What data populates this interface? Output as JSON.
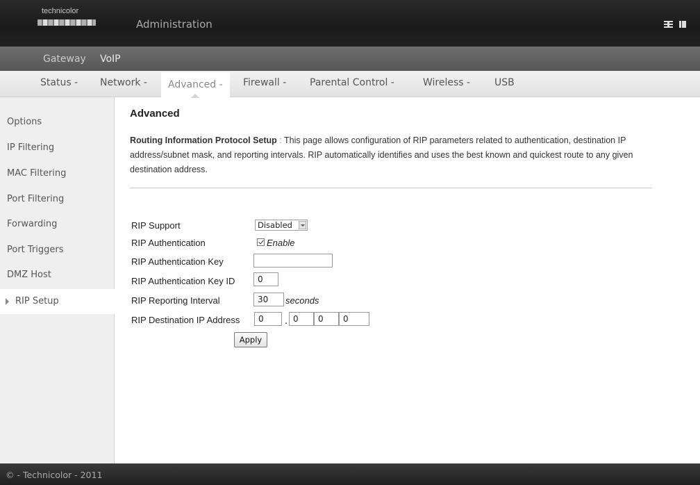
{
  "header": {
    "logo_text": "technicolor",
    "title": "Administration",
    "icons": [
      "language-icon",
      "logout-icon"
    ]
  },
  "subnav": {
    "items": [
      {
        "label": "Gateway"
      },
      {
        "label": "VoIP"
      }
    ]
  },
  "mainnav": {
    "items": [
      {
        "label": "Status -"
      },
      {
        "label": "Network -"
      },
      {
        "label": "Advanced -"
      },
      {
        "label": "Firewall -"
      },
      {
        "label": "Parental Control -"
      },
      {
        "label": "Wireless -"
      },
      {
        "label": "USB"
      }
    ],
    "active_index": 2
  },
  "sidebar": {
    "items": [
      {
        "label": "Options"
      },
      {
        "label": "IP Filtering"
      },
      {
        "label": "MAC Filtering"
      },
      {
        "label": "Port Filtering"
      },
      {
        "label": "Forwarding"
      },
      {
        "label": "Port Triggers"
      },
      {
        "label": "DMZ Host"
      },
      {
        "label": "RIP Setup"
      }
    ],
    "active_index": 7
  },
  "content": {
    "title": "Advanced",
    "desc_heading": "Routing Information Protocol Setup",
    "desc_sep": " : ",
    "desc_body": "This page allows configuration of RIP parameters related to authentication, destination IP address/subnet mask, and reporting intervals. RIP automatically identifies and uses the best known and quickest route to any given destination address."
  },
  "form": {
    "rip_support_label": "RIP Support",
    "rip_support_value": "Disabled",
    "rip_auth_label": "RIP Authentication",
    "rip_auth_checked": true,
    "rip_auth_check_label": "Enable",
    "rip_auth_key_label": "RIP Authentication Key",
    "rip_auth_key_value": "",
    "rip_auth_key_id_label": "RIP Authentication Key ID",
    "rip_auth_key_id_value": "0",
    "rip_interval_label": "RIP Reporting Interval",
    "rip_interval_value": "30",
    "rip_interval_unit": "seconds",
    "rip_dest_ip_label": "RIP Destination IP Address",
    "rip_dest_ip": [
      "0",
      "0",
      "0",
      "0"
    ],
    "ip_separator": ".",
    "apply_label": "Apply"
  },
  "footer": {
    "text": "© - Technicolor - 2011"
  }
}
